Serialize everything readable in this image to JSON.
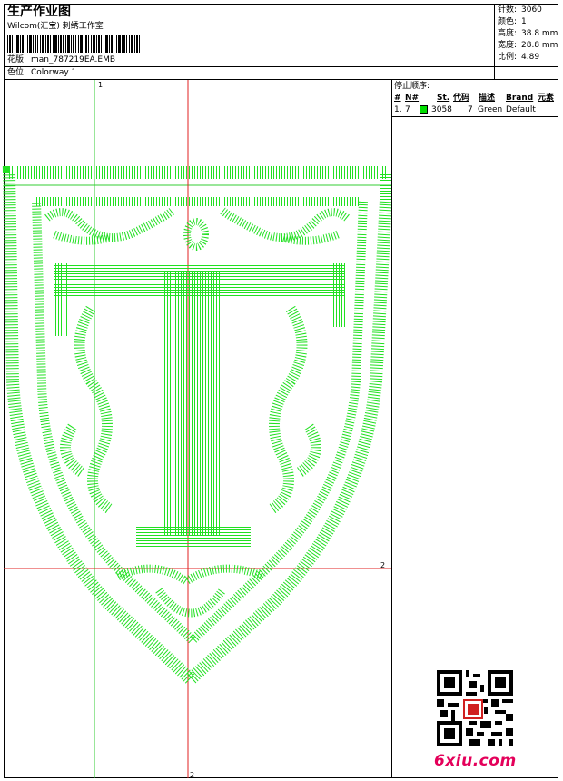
{
  "header": {
    "title": "生产作业图",
    "company": "Wilcom(汇宝) 刺绣工作室",
    "design_label": "花版:",
    "design_file": "man_787219EA.EMB",
    "colorway_label": "色位:",
    "colorway": "Colorway 1"
  },
  "stats": {
    "stitches_label": "针数:",
    "stitches": "3060",
    "colors_label": "颜色:",
    "colors": "1",
    "height_label": "高度:",
    "height": "38.8 mm",
    "width_label": "宽度:",
    "width": "28.8 mm",
    "scale_label": "比例:",
    "scale": "4.89"
  },
  "stop_sequence": {
    "label": "停止顺序:",
    "headers": [
      "#",
      "N#",
      "St.",
      "代码",
      "描述",
      "Brand",
      "元素"
    ],
    "rows": [
      {
        "index": "1.",
        "needle": "7",
        "stitches": "3058",
        "code": "7",
        "description": "Green",
        "brand": "Default",
        "color": "#00dd00"
      }
    ]
  },
  "guides": {
    "v1": "1",
    "h2": "2",
    "v2": "2"
  },
  "colors": {
    "stitch": "#22e022",
    "guide_green": "#33cc33",
    "guide_red": "#e02020"
  },
  "watermark": "6xiu.com"
}
